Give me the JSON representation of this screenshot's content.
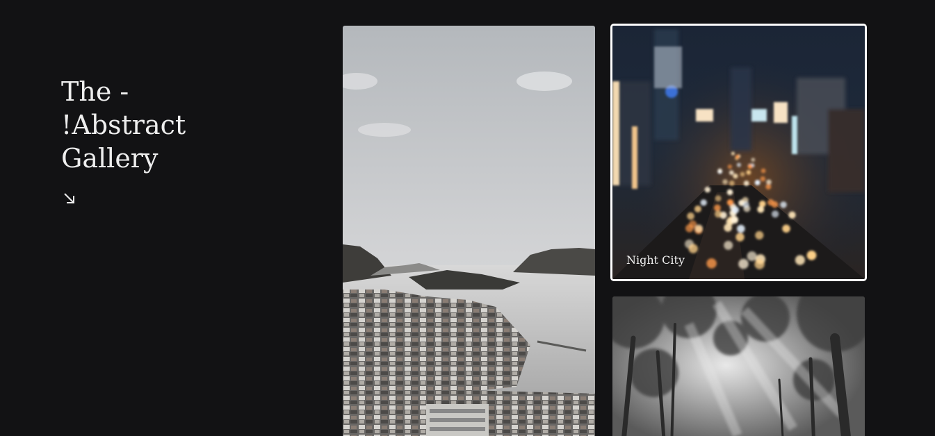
{
  "header": {
    "title_lines": [
      "The -",
      "!Abstract",
      "Gallery"
    ],
    "arrow_icon": "arrow-down-right-icon"
  },
  "gallery": {
    "items": [
      {
        "caption": "",
        "icon": "coastal-town-photo"
      },
      {
        "caption": "Night City",
        "icon": "night-city-photo"
      },
      {
        "caption": "",
        "icon": "forest-photo"
      }
    ]
  },
  "colors": {
    "background": "#121214",
    "text": "#eeeeee",
    "highlight_border": "#ffffff"
  }
}
